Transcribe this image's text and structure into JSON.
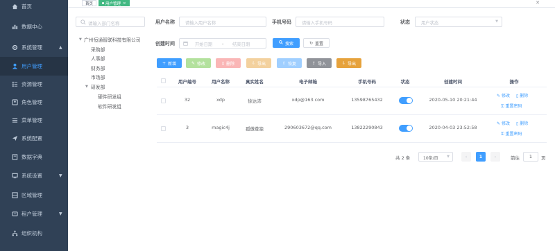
{
  "sidebar": {
    "items": [
      {
        "label": "首页",
        "icon": "home-icon"
      },
      {
        "label": "数据中心",
        "icon": "chart-icon"
      },
      {
        "label": "系统管理",
        "icon": "gear-icon",
        "expanded": true
      },
      {
        "label": "用户管理",
        "icon": "user-icon",
        "active": true
      },
      {
        "label": "资源管理",
        "icon": "list-icon"
      },
      {
        "label": "角色管理",
        "icon": "role-icon"
      },
      {
        "label": "菜单管理",
        "icon": "menu-icon"
      },
      {
        "label": "系统配置",
        "icon": "send-icon"
      },
      {
        "label": "数据字典",
        "icon": "book-icon"
      },
      {
        "label": "系统设置",
        "icon": "monitor-icon",
        "has_children": true
      },
      {
        "label": "区域管理",
        "icon": "map-icon"
      },
      {
        "label": "租户管理",
        "icon": "tenant-icon",
        "has_children": true
      },
      {
        "label": "组织机构",
        "icon": "org-icon"
      }
    ],
    "colors": {
      "bg": "#304156",
      "active_bg": "#263445",
      "active_text": "#409eff",
      "text": "#bfcbd9"
    }
  },
  "tags": {
    "home": "首页",
    "current": "用户管理"
  },
  "tree": {
    "search_placeholder": "请输入部门名称",
    "root": "广州恒通智联科技有限公司",
    "children": [
      "采购部",
      "人事部",
      "财务部",
      "市场部",
      "研发部"
    ],
    "dev_children": [
      "硬件研发组",
      "软件研发组"
    ]
  },
  "search": {
    "username_label": "用户名称",
    "username_placeholder": "请输入用户名称",
    "phone_label": "手机号码",
    "phone_placeholder": "请输入手机号码",
    "status_label": "状态",
    "status_placeholder": "用户状态",
    "created_label": "创建时间",
    "start_placeholder": "开始日期",
    "date_sep": "-",
    "end_placeholder": "结束日期",
    "search_btn": "搜索",
    "reset_btn": "重置"
  },
  "toolbar": {
    "add": "新增",
    "edit": "修改",
    "delete": "删除",
    "export": "导出",
    "reset_pwd": "恢复",
    "import": "导入",
    "export2": "导出"
  },
  "table": {
    "headers": [
      "用户编号",
      "用户名称",
      "真实姓名",
      "电子邮箱",
      "手机号码",
      "状态",
      "创建时间",
      "操作"
    ],
    "rows": [
      {
        "id": "32",
        "username": "xdp",
        "realname": "徐达沛",
        "email": "xdp@163.com",
        "phone": "13598765432",
        "status": true,
        "created": "2020-05-10 20:21:44"
      },
      {
        "id": "3",
        "username": "magic4j",
        "realname": "孤傲苍狼",
        "email": "290603672@qq.com",
        "phone": "13822290843",
        "status": true,
        "created": "2020-04-03 23:52:58"
      }
    ],
    "ops": {
      "edit": "修改",
      "delete": "删除",
      "reset": "重置密码"
    }
  },
  "pager": {
    "total": "共 2 条",
    "size": "10条/页",
    "page": "1",
    "goto": "前往",
    "jump": "1",
    "unit": "页"
  }
}
